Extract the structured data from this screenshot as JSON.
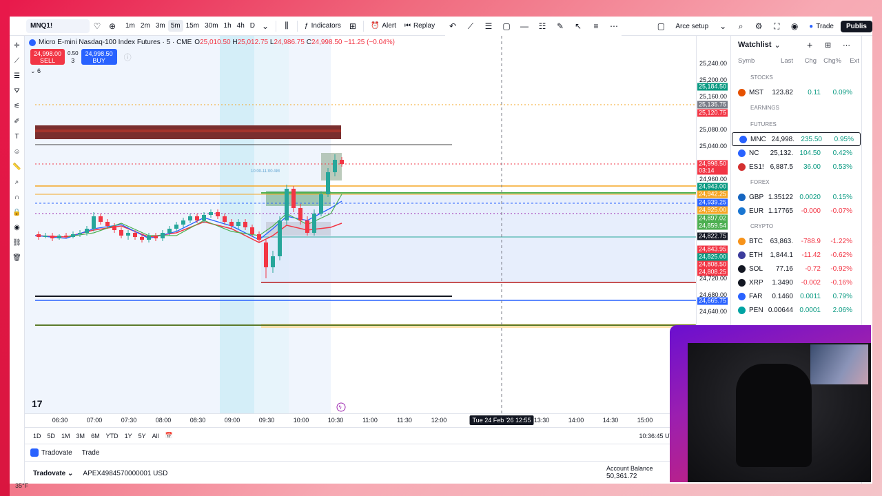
{
  "symbol": "MNQ1!",
  "intervals": [
    "1m",
    "2m",
    "3m",
    "5m",
    "15m",
    "30m",
    "1h",
    "4h",
    "D"
  ],
  "active_interval": "5m",
  "toolbar": {
    "indicators": "Indicators",
    "alert": "Alert",
    "replay": "Replay",
    "layout": "Arce setup",
    "trade": "Trade",
    "publish": "Publis"
  },
  "legend": {
    "title": "Micro E-mini Nasdaq-100 Index Futures · 5 · CME",
    "open": "25,010.50",
    "high": "25,012.75",
    "low": "24,986.75",
    "close": "24,998.50",
    "change": "−11.25 (−0.04%)",
    "o_label": "O",
    "h_label": "H",
    "l_label": "L",
    "c_label": "C"
  },
  "order": {
    "sell_price": "24,998.00",
    "sell_label": "SELL",
    "buy_price": "24,998.50",
    "buy_label": "BUY",
    "spread": "0.50",
    "qty": "3"
  },
  "indicator_count": "6",
  "session_label": "10:00-11:00 AM",
  "price_axis": [
    "25,240.00",
    "25,200.00",
    "25,160.00",
    "25,080.00",
    "25,040.00",
    "24,960.00",
    "24,720.00",
    "24,680.00",
    "24,640.00",
    "24,600.00"
  ],
  "price_badges": [
    {
      "text": "25,184.50",
      "color": "#089981"
    },
    {
      "text": "25,135.75",
      "color": "#787b86"
    },
    {
      "text": "25,120.75",
      "color": "#f23645"
    },
    {
      "text": "24,998.50",
      "color": "#f23645"
    },
    {
      "text": "03:14",
      "color": "#f23645"
    },
    {
      "text": "24,943.00",
      "color": "#089981"
    },
    {
      "text": "24,942.25",
      "color": "#f5a623"
    },
    {
      "text": "24,939.25",
      "color": "#2962ff"
    },
    {
      "text": "24,925.00",
      "color": "#f5a623"
    },
    {
      "text": "24,897.02",
      "color": "#4caf50"
    },
    {
      "text": "24,859.54",
      "color": "#4caf50"
    },
    {
      "text": "24,822.75",
      "color": "#131722"
    },
    {
      "text": "24,843.95",
      "color": "#f23645"
    },
    {
      "text": "24,825.00",
      "color": "#089981"
    },
    {
      "text": "24,808.50",
      "color": "#f23645"
    },
    {
      "text": "24,808.25",
      "color": "#f23645"
    },
    {
      "text": "24,665.75",
      "color": "#2962ff"
    }
  ],
  "time_axis": [
    "06:30",
    "07:00",
    "07:30",
    "08:00",
    "08:30",
    "09:00",
    "09:30",
    "10:00",
    "10:30",
    "11:00",
    "11:30",
    "12:00",
    "13:30",
    "14:00",
    "14:30",
    "15:00",
    "15"
  ],
  "crosshair_time": "Tue 24 Feb '26   12:55",
  "ranges": [
    "1D",
    "5D",
    "1M",
    "3M",
    "6M",
    "YTD",
    "1Y",
    "5Y",
    "All"
  ],
  "clock": "10:36:45 UT",
  "bottom_tabs": [
    "Tradovate",
    "Trade"
  ],
  "broker": {
    "name": "Tradovate",
    "account": "APEX4984570000001 USD",
    "balance_label": "Account Balance",
    "balance": "50,361.72",
    "eq_label": "Eq",
    "eq_value": "50"
  },
  "watchlist": {
    "title": "Watchlist",
    "columns": [
      "Symb",
      "Last",
      "Chg",
      "Chg%",
      "Ext"
    ],
    "sections": [
      "STOCKS",
      "EARNINGS",
      "FUTURES",
      "FOREX",
      "CRYPTO"
    ],
    "rows": [
      {
        "sym": "MST",
        "last": "123.82",
        "chg": "0.11",
        "chgp": "0.09%",
        "dir": "pos",
        "color": "#e65100"
      },
      {
        "sym": "MNC",
        "last": "24,998.",
        "chg": "235.50",
        "chgp": "0.95%",
        "dir": "pos",
        "color": "#2962ff"
      },
      {
        "sym": "NC",
        "last": "25,132.",
        "chg": "104.50",
        "chgp": "0.42%",
        "dir": "pos",
        "color": "#2962ff"
      },
      {
        "sym": "ES1!",
        "last": "6,887.5",
        "chg": "36.00",
        "chgp": "0.53%",
        "dir": "pos",
        "color": "#d32f2f"
      },
      {
        "sym": "GBP",
        "last": "1.35122",
        "chg": "0.0020",
        "chgp": "0.15%",
        "dir": "pos",
        "color": "#1565c0"
      },
      {
        "sym": "EUR",
        "last": "1.17765",
        "chg": "-0.000",
        "chgp": "-0.07%",
        "dir": "neg",
        "color": "#1976d2"
      },
      {
        "sym": "BTC",
        "last": "63,863.",
        "chg": "-788.9",
        "chgp": "-1.22%",
        "dir": "neg",
        "color": "#f7931a"
      },
      {
        "sym": "ETH",
        "last": "1,844.1",
        "chg": "-11.42",
        "chgp": "-0.62%",
        "dir": "neg",
        "color": "#3c3c9c"
      },
      {
        "sym": "SOL",
        "last": "77.16",
        "chg": "-0.72",
        "chgp": "-0.92%",
        "dir": "neg",
        "color": "#131722"
      },
      {
        "sym": "XRP",
        "last": "1.3490",
        "chg": "-0.002",
        "chgp": "-0.16%",
        "dir": "neg",
        "color": "#131722"
      },
      {
        "sym": "FAR",
        "last": "0.1460",
        "chg": "0.0011",
        "chgp": "0.79%",
        "dir": "pos",
        "color": "#2962ff"
      },
      {
        "sym": "PEN",
        "last": "0.00644",
        "chg": "0.0001",
        "chgp": "2.06%",
        "dir": "pos",
        "color": "#00a3a3"
      }
    ]
  },
  "taskbar_temp": "35°F"
}
